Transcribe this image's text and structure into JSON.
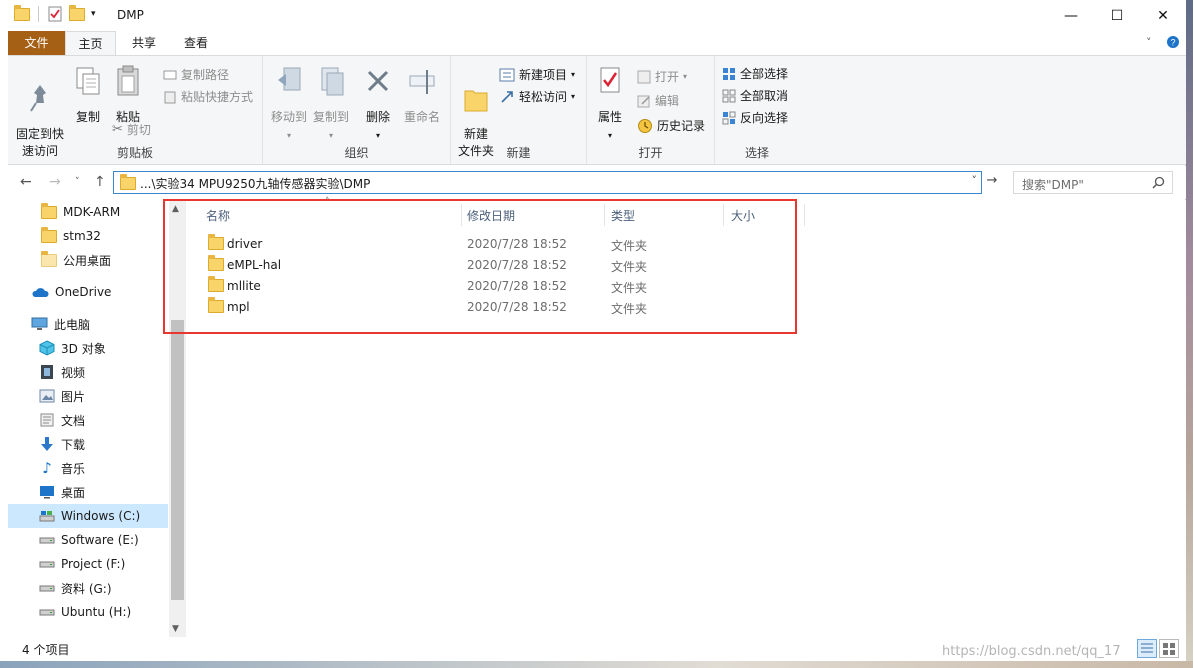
{
  "window": {
    "title": "DMP"
  },
  "tabs": {
    "file": "文件",
    "home": "主页",
    "share": "共享",
    "view": "查看"
  },
  "ribbon": {
    "clipboard": {
      "pin": "固定到快\n速访问",
      "copy": "复制",
      "paste": "粘贴",
      "copy_path": "复制路径",
      "paste_shortcut": "粘贴快捷方式",
      "cut": "剪切",
      "label": "剪贴板"
    },
    "organize": {
      "move_to": "移动到",
      "copy_to": "复制到",
      "delete": "删除",
      "rename": "重命名",
      "label": "组织"
    },
    "new": {
      "new_folder": "新建\n文件夹",
      "new_item": "新建项目",
      "easy_access": "轻松访问",
      "label": "新建"
    },
    "open": {
      "properties": "属性",
      "open": "打开",
      "edit": "编辑",
      "history": "历史记录",
      "label": "打开"
    },
    "select": {
      "select_all": "全部选择",
      "select_none": "全部取消",
      "invert": "反向选择",
      "label": "选择"
    }
  },
  "address": {
    "path": "...\\实验34 MPU9250九轴传感器实验\\DMP",
    "search_placeholder": "搜索\"DMP\""
  },
  "nav": {
    "items": [
      {
        "label": "MDK-ARM",
        "icon": "folder-icon"
      },
      {
        "label": "stm32",
        "icon": "folder-icon"
      },
      {
        "label": "公用桌面",
        "icon": "folder-icon"
      },
      {
        "label": "OneDrive",
        "icon": "cloud-icon"
      },
      {
        "label": "此电脑",
        "icon": "computer-icon"
      },
      {
        "label": "3D 对象",
        "icon": "cube-icon"
      },
      {
        "label": "视频",
        "icon": "video-icon"
      },
      {
        "label": "图片",
        "icon": "picture-icon"
      },
      {
        "label": "文档",
        "icon": "document-icon"
      },
      {
        "label": "下载",
        "icon": "download-icon"
      },
      {
        "label": "音乐",
        "icon": "music-icon"
      },
      {
        "label": "桌面",
        "icon": "desktop-icon"
      },
      {
        "label": "Windows (C:)",
        "icon": "drive-icon"
      },
      {
        "label": "Software (E:)",
        "icon": "drive-icon"
      },
      {
        "label": "Project (F:)",
        "icon": "drive-icon"
      },
      {
        "label": "资料 (G:)",
        "icon": "drive-icon"
      },
      {
        "label": "Ubuntu (H:)",
        "icon": "drive-icon"
      }
    ]
  },
  "files": {
    "headers": {
      "name": "名称",
      "date": "修改日期",
      "type": "类型",
      "size": "大小"
    },
    "rows": [
      {
        "name": "driver",
        "date": "2020/7/28 18:52",
        "type": "文件夹"
      },
      {
        "name": "eMPL-hal",
        "date": "2020/7/28 18:52",
        "type": "文件夹"
      },
      {
        "name": "mllite",
        "date": "2020/7/28 18:52",
        "type": "文件夹"
      },
      {
        "name": "mpl",
        "date": "2020/7/28 18:52",
        "type": "文件夹"
      }
    ]
  },
  "status": {
    "count": "4 个项目",
    "watermark": "https://blog.csdn.net/qq_17"
  },
  "colors": {
    "file_tab": "#a66015",
    "selection": "#cce8ff",
    "highlight_box": "#e8372e",
    "address_border": "#3a86d0"
  }
}
